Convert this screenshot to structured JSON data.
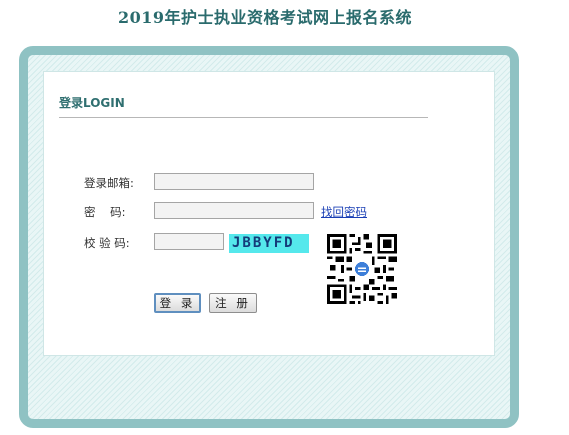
{
  "page": {
    "title": "2019年护士执业资格考试网上报名系统"
  },
  "login": {
    "heading": "登录LOGIN",
    "email_label": "登录邮箱:",
    "email_value": "",
    "password_label": "密    码:",
    "password_value": "",
    "captcha_label": "校 验 码:",
    "captcha_value": "",
    "captcha_text": "JBBYFD",
    "forgot_link": "找回密码",
    "login_button": "登 录",
    "register_button": "注 册"
  },
  "icons": {
    "qr": "qr-code-icon"
  },
  "colors": {
    "title": "#2a6b6d",
    "frame_border": "#8fc2c3",
    "captcha_bg": "#55e8ec",
    "link": "#1a3fb5"
  }
}
